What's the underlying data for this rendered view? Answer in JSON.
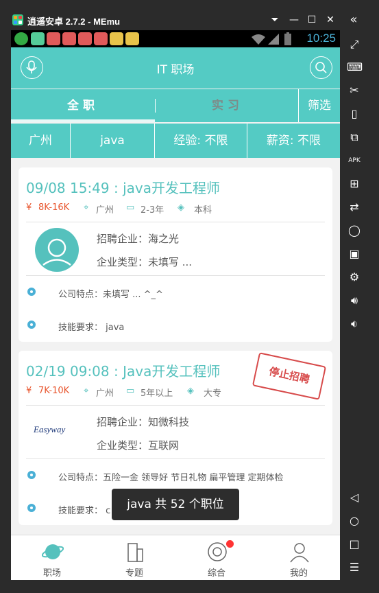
{
  "window": {
    "title": "逍遥安卓 2.7.2 - MEmu"
  },
  "status_bar": {
    "time": "10:25"
  },
  "app_bar": {
    "title": "IT 职场"
  },
  "tabs": [
    {
      "label": "全职",
      "active": true
    },
    {
      "label": "实习",
      "active": false
    }
  ],
  "filter_button": "筛选",
  "filters": {
    "city": "广州",
    "keyword": "java",
    "experience": "经验: 不限",
    "salary": "薪资: 不限"
  },
  "jobs": [
    {
      "title": "09/08 15:49 : java开发工程师",
      "salary": "8K-16K",
      "city": "广州",
      "experience": "2-3年",
      "education": "本科",
      "company": "招聘企业：海之光",
      "company_type": "企业类型：未填写 ...",
      "features": "公司特点：未填写 ... ^_^",
      "skills": "技能要求： java",
      "logo": "avatar-placeholder"
    },
    {
      "title": "02/19 09:08 : Java开发工程师",
      "salary": "7K-10K",
      "city": "广州",
      "experience": "5年以上",
      "education": "大专",
      "company": "招聘企业：知微科技",
      "company_type": "企业类型：互联网",
      "features": "公司特点：五险一金 领导好 节日礼物 扁平管理 定期体检",
      "skills": "技能要求： c",
      "stamp": "停止招聘",
      "logo_text": "Easyway"
    }
  ],
  "toast": "java 共 52 个职位",
  "bottom_nav": [
    {
      "label": "职场",
      "icon": "planet-icon"
    },
    {
      "label": "专题",
      "icon": "building-icon"
    },
    {
      "label": "综合",
      "icon": "at-icon",
      "badge": true
    },
    {
      "label": "我的",
      "icon": "user-icon"
    }
  ],
  "colors": {
    "accent": "#54cbc4",
    "title_text": "#55c1bd",
    "salary": "#e8542c",
    "stamp": "#d74a4a"
  }
}
